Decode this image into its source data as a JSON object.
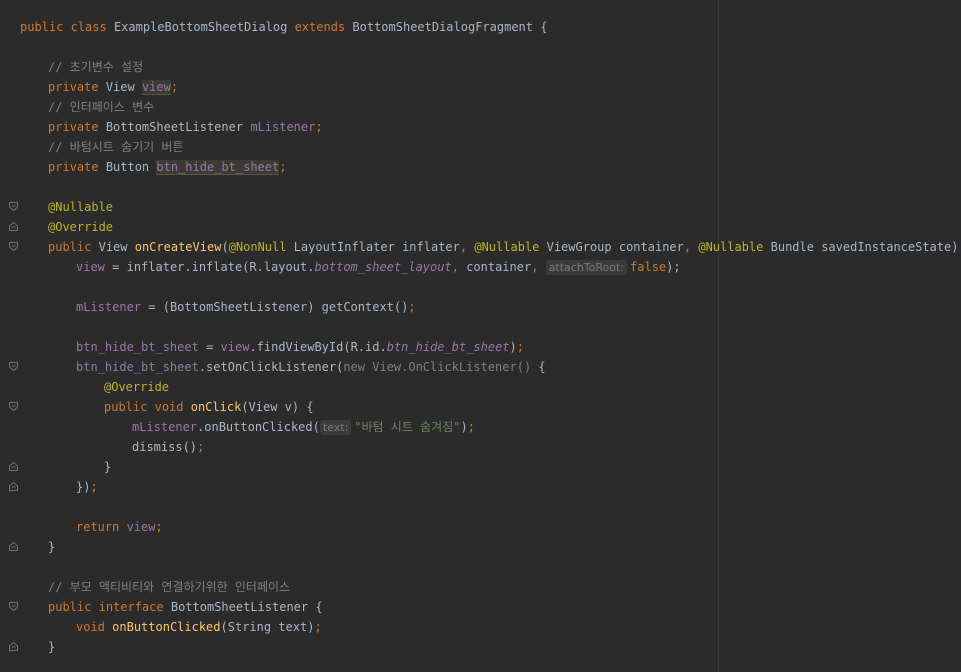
{
  "colors": {
    "background": "#2b2b2b",
    "keyword": "#cc7832",
    "field": "#9876aa",
    "method": "#ffc66d",
    "annotation": "#bbb529",
    "comment": "#808080",
    "string": "#6a8759",
    "text": "#a9b7c6"
  },
  "code": {
    "l1": {
      "kw1": "public",
      "kw2": "class",
      "name": "ExampleBottomSheetDialog",
      "kw3": "extends",
      "parent": "BottomSheetDialogFragment",
      "brace": "{"
    },
    "l2": {
      "comment": "// 초기변수 설정"
    },
    "l3": {
      "kw": "private",
      "type": "View",
      "field": "view",
      "semi": ";"
    },
    "l4": {
      "comment": "// 인터페이스 변수"
    },
    "l5": {
      "kw": "private",
      "type": "BottomSheetListener",
      "field": "mListener",
      "semi": ";"
    },
    "l6": {
      "comment": "// 바텀시트 숨기기 버튼"
    },
    "l7": {
      "kw": "private",
      "type": "Button",
      "field": "btn_hide_bt_sheet",
      "semi": ";"
    },
    "l8": {
      "ann": "@Nullable"
    },
    "l9": {
      "ann": "@Override"
    },
    "l10": {
      "kw": "public",
      "type": "View",
      "method": "onCreateView",
      "p1": "(",
      "ann1": "@NonNull",
      "t1": "LayoutInflater inflater",
      "c1": ",",
      "ann2": "@Nullable",
      "t2": "ViewGroup container",
      "c2": ",",
      "ann3": "@Nullable",
      "t3": "Bundle savedInstanceState) {"
    },
    "l11": {
      "field": "view",
      "t1": "= inflater.inflate(R.layout.",
      "ital": "bottom_sheet_layout",
      "c1": ",",
      "t2": "container",
      "c2": ",",
      "hint": "attachToRoot:",
      "kw": "false",
      "end": ");"
    },
    "l12": {
      "field": "mListener",
      "t1": "= (BottomSheetListener) getContext()",
      "semi": ";"
    },
    "l13": {
      "field": "btn_hide_bt_sheet",
      "t1": "=",
      "field2": "view",
      "t2": ".findViewById(R.id.",
      "ital": "btn_hide_bt_sheet",
      "end": ")",
      "semi": ";"
    },
    "l14": {
      "field": "btn_hide_bt_sheet",
      "t1": ".setOnClickListener(",
      "anon": "new View.OnClickListener()",
      "t2": "{"
    },
    "l15": {
      "ann": "@Override"
    },
    "l16": {
      "kw1": "public",
      "kw2": "void",
      "method": "onClick",
      "t1": "(View v) {"
    },
    "l17": {
      "field": "mListener",
      "t1": ".onButtonClicked(",
      "hint": "text:",
      "str": "\"바텀 시트 숨겨짐\"",
      "end": ")",
      "semi": ";"
    },
    "l18": {
      "t1": "dismiss()",
      "semi": ";"
    },
    "l19": {
      "t1": "}"
    },
    "l20": {
      "t1": "})",
      "semi": ";"
    },
    "l21": {
      "kw": "return",
      "field": "view",
      "semi": ";"
    },
    "l22": {
      "t1": "}"
    },
    "l23": {
      "comment": "// 부모 액티비티와 연결하기위한 인터페이스"
    },
    "l24": {
      "kw1": "public",
      "kw2": "interface",
      "name": "BottomSheetListener",
      "brace": "{"
    },
    "l25": {
      "kw": "void",
      "method": "onButtonClicked",
      "t1": "(String text)",
      "semi": ";"
    },
    "l26": {
      "t1": "}"
    }
  }
}
